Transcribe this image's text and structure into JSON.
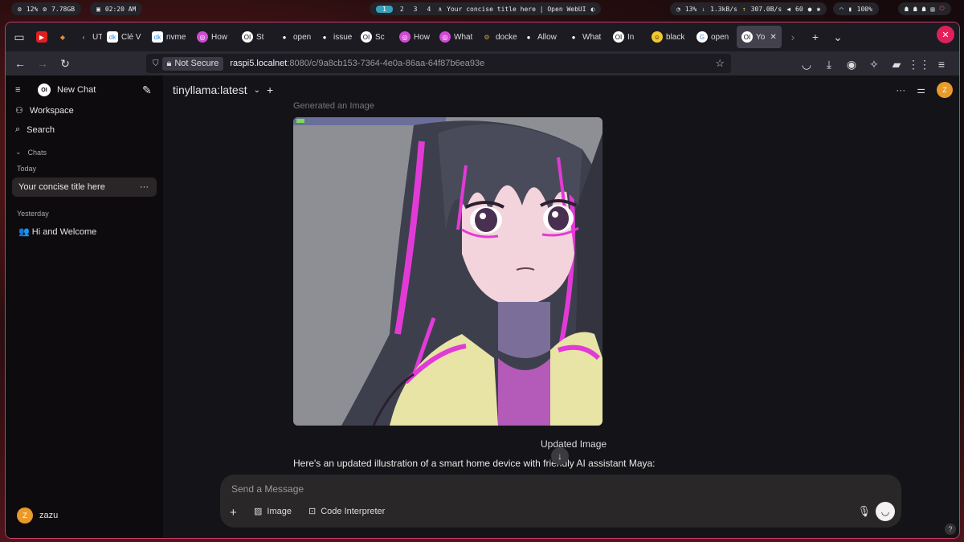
{
  "system": {
    "cpu": "12%",
    "mem": "7.78GB",
    "time": "02:20 AM",
    "workspaces": [
      "1",
      "2",
      "3",
      "4"
    ],
    "active_window_title": "Your concise title here | Open WebUI",
    "stat_cpu2": "13%",
    "net_down": "1.3kB/s",
    "net_up": "307.0B/s",
    "volume": "60",
    "battery": "100%"
  },
  "tabs": [
    {
      "label": "UT",
      "icon": "chevron-icon",
      "color": "#888"
    },
    {
      "label": "Clé V",
      "icon": "dk-icon",
      "color": "#3a8ee6"
    },
    {
      "label": "nvme",
      "icon": "dk-icon",
      "color": "#3a8ee6"
    },
    {
      "label": "How",
      "icon": "circle-icon",
      "color": "#d04ad4"
    },
    {
      "label": "St",
      "icon": "openwebui-icon",
      "color": "#fff"
    },
    {
      "label": "open",
      "icon": "github-icon",
      "color": "#fff"
    },
    {
      "label": "issue",
      "icon": "github-icon",
      "color": "#fff"
    },
    {
      "label": "Sc",
      "icon": "openwebui-icon",
      "color": "#fff"
    },
    {
      "label": "How",
      "icon": "circle-icon",
      "color": "#d04ad4"
    },
    {
      "label": "What",
      "icon": "circle-icon",
      "color": "#d04ad4"
    },
    {
      "label": "docke",
      "icon": "gear-icon",
      "color": "#c8a040"
    },
    {
      "label": "Allow",
      "icon": "github-icon",
      "color": "#fff"
    },
    {
      "label": "What",
      "icon": "github-icon",
      "color": "#fff"
    },
    {
      "label": "In",
      "icon": "openwebui-icon",
      "color": "#fff"
    },
    {
      "label": "black",
      "icon": "smile-icon",
      "color": "#f2c830"
    },
    {
      "label": "open",
      "icon": "google-icon",
      "color": "#4a8af4"
    },
    {
      "label": "Yo",
      "icon": "openwebui-icon",
      "color": "#fff"
    }
  ],
  "url": {
    "security": "Not Secure",
    "host": "raspi5.localnet",
    "path": ":8080/c/9a8cb153-7364-4e0a-86aa-64f87b6ea93e"
  },
  "sidebar": {
    "new_chat": "New Chat",
    "workspace": "Workspace",
    "search": "Search",
    "chats": "Chats",
    "today": "Today",
    "today_item": "Your concise title here",
    "yesterday": "Yesterday",
    "yesterday_item": "👥 Hi and Welcome",
    "user_initial": "Z",
    "user_name": "zazu"
  },
  "main": {
    "model": "tinyllama:latest",
    "generated_label": "Generated an Image",
    "caption": "Updated Image",
    "message": "Here's an updated illustration of a smart home device with friendly AI assistant Maya:",
    "placeholder": "Send a Message",
    "image_btn": "Image",
    "code_btn": "Code Interpreter",
    "user_initial": "Z"
  },
  "colors": {
    "accent": "#e89a2a",
    "window_border": "#c83c6a"
  }
}
